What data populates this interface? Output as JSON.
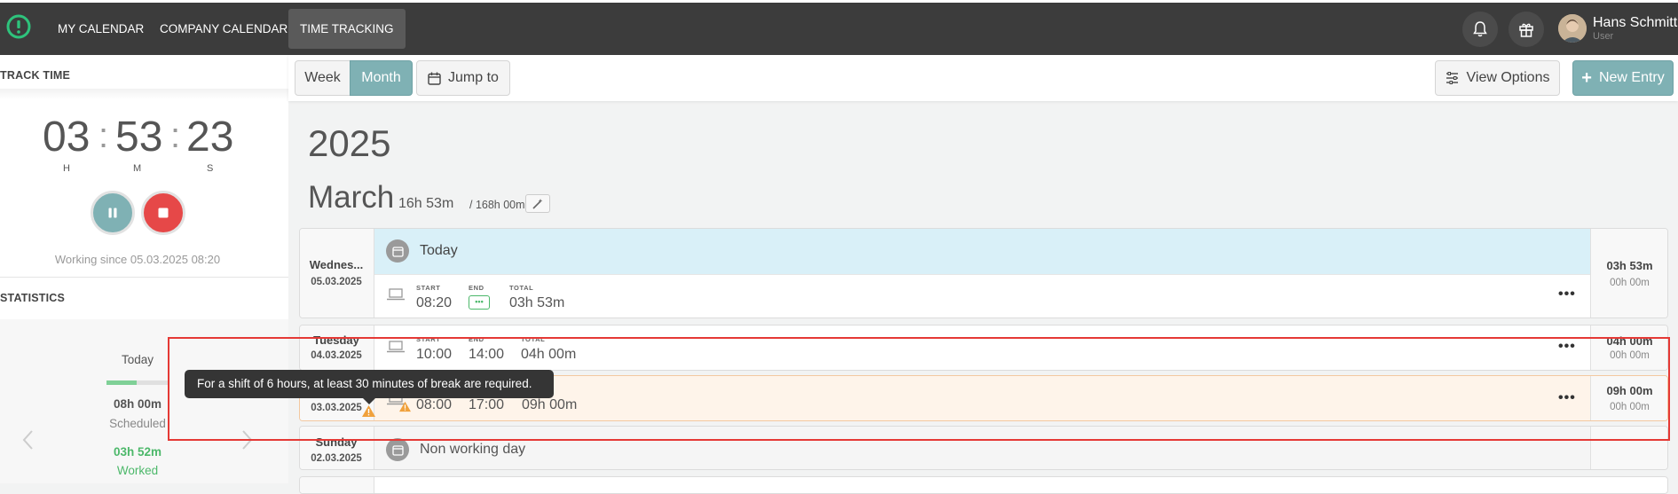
{
  "nav": {
    "items": [
      "MY CALENDAR",
      "COMPANY CALENDAR",
      "TIME TRACKING"
    ],
    "active": "TIME TRACKING"
  },
  "user": {
    "name": "Hans Schmitt",
    "role": "User"
  },
  "track_time": {
    "title": "TRACK TIME",
    "hours": "03",
    "minutes": "53",
    "seconds": "23",
    "units": [
      "H",
      "M",
      "S"
    ],
    "working_since": "Working since 05.03.2025 08:20"
  },
  "statistics": {
    "title": "STATISTICS",
    "period": "Today",
    "scheduled_value": "08h 00m",
    "scheduled_label": "Scheduled",
    "worked_value": "03h 52m",
    "worked_label": "Worked"
  },
  "toolbar": {
    "week": "Week",
    "month": "Month",
    "jump_to": "Jump to",
    "view_options": "View Options",
    "new_entry": "New Entry"
  },
  "header": {
    "year": "2025",
    "month": "March",
    "month_hours": "16h 53m",
    "month_target": "/ 168h 00m"
  },
  "labels": {
    "start": "START",
    "end": "END",
    "total": "TOTAL"
  },
  "days": [
    {
      "name": "Wednes...",
      "date": "05.03.2025",
      "banner": "Today",
      "start": "08:20",
      "end": "•••",
      "total": "03h 53m",
      "day_total": "03h 53m",
      "day_sub": "00h 00m"
    },
    {
      "name": "Tuesday",
      "date": "04.03.2025",
      "start": "10:00",
      "end": "14:00",
      "total": "04h 00m",
      "day_total": "04h 00m",
      "day_sub": "00h 00m"
    },
    {
      "date": "03.03.2025",
      "start": "08:00",
      "end": "17:00",
      "total": "09h 00m",
      "day_total": "09h 00m",
      "day_sub": "00h 00m"
    },
    {
      "name": "Sunday",
      "date": "02.03.2025",
      "banner": "Non working day"
    }
  ],
  "tooltip": "For a shift of 6 hours, at least 30 minutes of break are required.",
  "colors": {
    "accent": "#7fb1b4",
    "stop": "#e64848",
    "today_banner": "#d9f0f8",
    "warning_row": "#fef4ea",
    "warning": "#f0a13c",
    "worked": "#4cb86a"
  }
}
